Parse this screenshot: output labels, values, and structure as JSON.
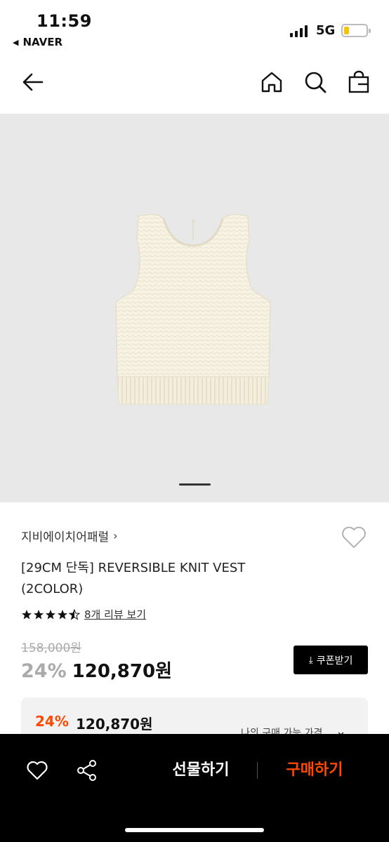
{
  "status_bar": {
    "time": "11:59",
    "back_app": "NAVER",
    "network": "5G",
    "battery_level": 0.2
  },
  "nav": {
    "back_icon": "arrow-left-icon",
    "home_icon": "home-icon",
    "search_icon": "search-icon",
    "cart_icon": "shopping-bag-icon"
  },
  "gallery": {
    "image_icon": "knit-vest-image",
    "current_slide": 1
  },
  "product": {
    "brand": "지비에이치어패럴",
    "title": "[29CM 단독] REVERSIBLE KNIT VEST (2COLOR)",
    "rating_stars": 4.5,
    "review_link": "8개 리뷰 보기",
    "original_price": "158,000원",
    "discount": "24%",
    "price": "120,870원",
    "coupon_button": "쿠폰받기"
  },
  "my_price": {
    "discount": "24%",
    "price": "120,870원",
    "label": "나의 구매 가능 가격"
  },
  "bottom_bar": {
    "gift_button": "선물하기",
    "buy_button": "구매하기"
  },
  "colors": {
    "accent": "#ff4800",
    "image_bg": "#e8e8e8",
    "battery": "#f5c400"
  }
}
